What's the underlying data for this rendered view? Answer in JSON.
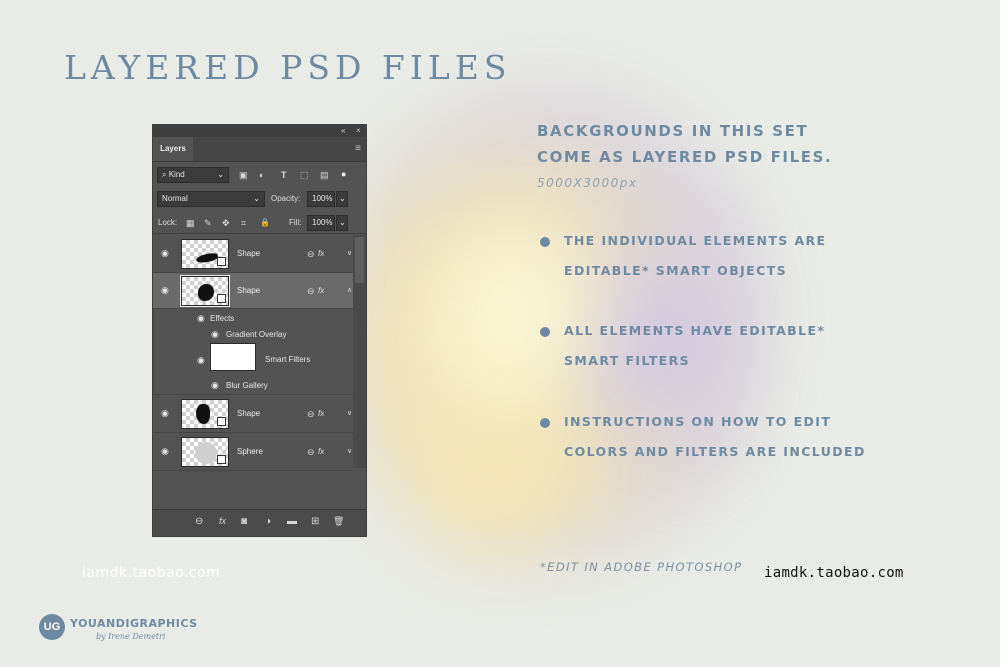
{
  "title": "LAYERED PSD FILES",
  "layers_panel": {
    "tab_label": "Layers",
    "kind_filter": "Kind",
    "blend_mode": "Normal",
    "opacity_label": "Opacity:",
    "opacity_value": "100%",
    "lock_label": "Lock:",
    "fill_label": "Fill:",
    "fill_value": "100%",
    "icons": {
      "collapse": "«",
      "close": "×",
      "menu": "≡",
      "search": "⌕",
      "image_filter": "▣",
      "adjustment_filter": "◐",
      "type_filter": "T",
      "shape_filter": "⬚",
      "smart_filter": "▤",
      "toggle": "●",
      "eye": "◉",
      "chevron_down": "∨",
      "chevron_up": "∧",
      "link": "⊖",
      "fx": "fx",
      "mask": "◙",
      "adjust": "◑",
      "folder": "▬",
      "new_layer": "⊞",
      "trash": "🗑",
      "dropdown": "⌄",
      "lock_pixels": "▦",
      "lock_brush": "✎",
      "lock_move": "✥",
      "lock_artboard": "⌗",
      "lock_all": "🔒"
    },
    "layers": [
      {
        "name": "Shape",
        "fx": "fx",
        "selected": false
      },
      {
        "name": "Shape",
        "fx": "fx",
        "selected": true
      },
      {
        "name": "Shape",
        "fx": "fx",
        "selected": false
      },
      {
        "name": "Sphere",
        "fx": "fx",
        "selected": false
      }
    ],
    "effects": {
      "effects_label": "Effects",
      "gradient_overlay": "Gradient Overlay",
      "smart_filters": "Smart Filters",
      "blur_gallery": "Blur Gallery"
    }
  },
  "info": {
    "heading_line1": "BACKGROUNDS IN THIS SET",
    "heading_line2": "COME AS LAYERED PSD FILES.",
    "resolution": "5000X3000px",
    "bullets": [
      {
        "line1": "THE INDIVIDUAL ELEMENTS ARE",
        "line2": "EDITABLE* SMART OBJECTS"
      },
      {
        "line1": "ALL ELEMENTS HAVE EDITABLE*",
        "line2": "SMART FILTERS"
      },
      {
        "line1": "INSTRUCTIONS ON HOW TO EDIT",
        "line2": "COLORS AND FILTERS ARE INCLUDED"
      }
    ],
    "footnote": "*EDIT IN ADOBE PHOTOSHOP"
  },
  "watermarks": {
    "left": "iamdk.taobao.com",
    "right": "iamdk.taobao.com"
  },
  "brand": {
    "logo_text": "UG",
    "name": "YOUANDIGRAPHICS",
    "byline": "by Irene Demetri"
  },
  "colors": {
    "accent": "#6e8aa2",
    "panel_bg": "#535353",
    "background": "#e9ebe6"
  }
}
